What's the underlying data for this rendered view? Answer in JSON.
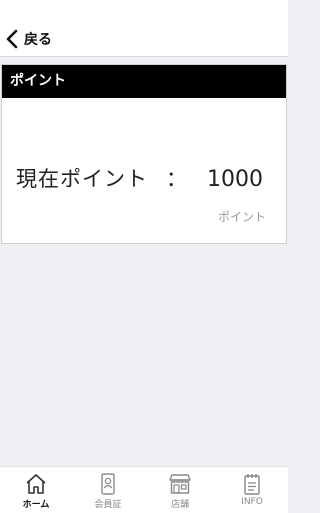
{
  "header": {
    "back_label": "戻る"
  },
  "card": {
    "title": "ポイント",
    "points_label": "現在ポイント",
    "separator": "：",
    "points_value": "1000",
    "unit": "ポイント"
  },
  "tabs": [
    {
      "label": "ホーム",
      "icon": "home-icon",
      "active": true
    },
    {
      "label": "会員証",
      "icon": "member-card-icon",
      "active": false
    },
    {
      "label": "店舗",
      "icon": "store-icon",
      "active": false
    },
    {
      "label": "INFO",
      "icon": "notepad-icon",
      "active": false
    }
  ]
}
